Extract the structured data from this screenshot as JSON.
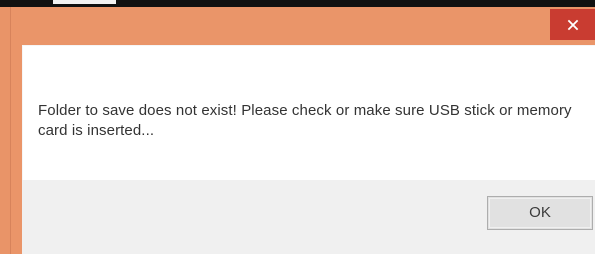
{
  "dialog": {
    "message": "Folder to save does not exist! Please check or make sure USB stick or memory card is inserted...",
    "ok_label": "OK",
    "close_icon": "close-icon"
  },
  "colors": {
    "frame": "#ea9569",
    "close_button": "#c93c31",
    "content": "#ffffff",
    "footer": "#f0f0f0",
    "ok_button": "#e1e1e1",
    "text": "#333333"
  }
}
